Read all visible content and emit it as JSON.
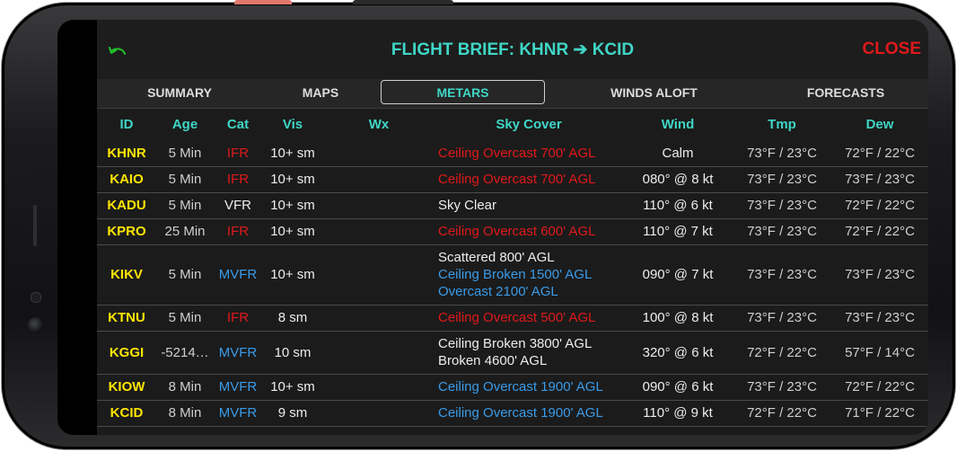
{
  "header": {
    "title": "FLIGHT BRIEF: KHNR ➔ KCID",
    "close_label": "CLOSE"
  },
  "tabs": [
    "SUMMARY",
    "MAPS",
    "METARS",
    "WINDS ALOFT",
    "FORECASTS"
  ],
  "active_tab": "METARS",
  "columns": [
    "ID",
    "Age",
    "Cat",
    "Vis",
    "Wx",
    "Sky Cover",
    "Wind",
    "Tmp",
    "Dew"
  ],
  "colors": {
    "accent": "#3fd6c6",
    "ifr": "#e0191b",
    "mvfr": "#3a9be8",
    "id": "#ffe500",
    "close": "#e0191b"
  },
  "rows": [
    {
      "id": "KHNR",
      "age": "5 Min",
      "cat": "IFR",
      "vis": "10+ sm",
      "wx": "",
      "sky": [
        {
          "text": "Ceiling Overcast 700' AGL",
          "color": "red"
        }
      ],
      "wind": "Calm",
      "tmp": "73°F / 23°C",
      "dew": "72°F / 22°C"
    },
    {
      "id": "KAIO",
      "age": "5 Min",
      "cat": "IFR",
      "vis": "10+ sm",
      "wx": "",
      "sky": [
        {
          "text": "Ceiling Overcast 700' AGL",
          "color": "red"
        }
      ],
      "wind": "080° @ 8 kt",
      "tmp": "73°F / 23°C",
      "dew": "73°F / 23°C"
    },
    {
      "id": "KADU",
      "age": "5 Min",
      "cat": "VFR",
      "vis": "10+ sm",
      "wx": "",
      "sky": [
        {
          "text": "Sky Clear",
          "color": "white"
        }
      ],
      "wind": "110° @ 6 kt",
      "tmp": "73°F / 23°C",
      "dew": "72°F / 22°C"
    },
    {
      "id": "KPRO",
      "age": "25 Min",
      "cat": "IFR",
      "vis": "10+ sm",
      "wx": "",
      "sky": [
        {
          "text": "Ceiling Overcast 600' AGL",
          "color": "red"
        }
      ],
      "wind": "110° @ 7 kt",
      "tmp": "73°F / 23°C",
      "dew": "72°F / 22°C"
    },
    {
      "id": "KIKV",
      "age": "5 Min",
      "cat": "MVFR",
      "vis": "10+ sm",
      "wx": "",
      "sky": [
        {
          "text": "Scattered 800' AGL",
          "color": "white"
        },
        {
          "text": "Ceiling Broken 1500' AGL",
          "color": "blue"
        },
        {
          "text": "Overcast 2100' AGL",
          "color": "blue"
        }
      ],
      "wind": "090° @ 7 kt",
      "tmp": "73°F / 23°C",
      "dew": "73°F / 23°C"
    },
    {
      "id": "KTNU",
      "age": "5 Min",
      "cat": "IFR",
      "vis": "8 sm",
      "wx": "",
      "sky": [
        {
          "text": "Ceiling Overcast 500' AGL",
          "color": "red"
        }
      ],
      "wind": "100° @ 8 kt",
      "tmp": "73°F / 23°C",
      "dew": "73°F / 23°C"
    },
    {
      "id": "KGGI",
      "age": "-5214…",
      "cat": "MVFR",
      "vis": "10 sm",
      "wx": "",
      "sky": [
        {
          "text": "Ceiling Broken 3800' AGL",
          "color": "white"
        },
        {
          "text": "Broken 4600' AGL",
          "color": "white"
        }
      ],
      "wind": "320° @ 6 kt",
      "tmp": "72°F / 22°C",
      "dew": "57°F / 14°C"
    },
    {
      "id": "KIOW",
      "age": "8 Min",
      "cat": "MVFR",
      "vis": "10+ sm",
      "wx": "",
      "sky": [
        {
          "text": "Ceiling Overcast 1900' AGL",
          "color": "blue"
        }
      ],
      "wind": "090° @ 6 kt",
      "tmp": "73°F / 23°C",
      "dew": "72°F / 22°C"
    },
    {
      "id": "KCID",
      "age": "8 Min",
      "cat": "MVFR",
      "vis": "9 sm",
      "wx": "",
      "sky": [
        {
          "text": "Ceiling Overcast 1900' AGL",
          "color": "blue"
        }
      ],
      "wind": "110° @ 9 kt",
      "tmp": "72°F / 22°C",
      "dew": "71°F / 22°C"
    }
  ]
}
